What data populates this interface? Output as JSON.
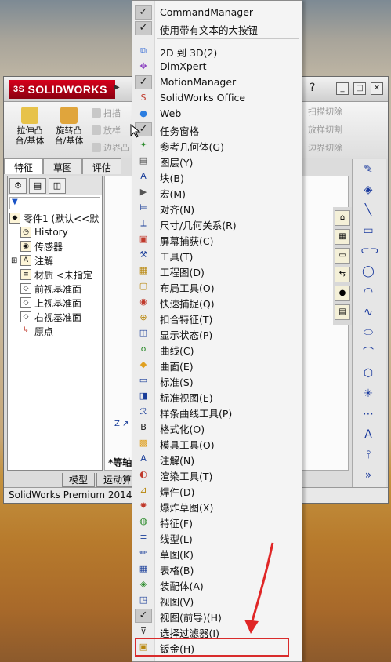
{
  "app": {
    "logo_prefix": "3S",
    "logo_text": "SOLIDWORKS",
    "help": "?",
    "window_buttons": [
      "_",
      "□",
      "✕"
    ]
  },
  "ribbon": {
    "extrude_boss": "拉伸凸台/基体",
    "revolve_boss": "旋转凸台/基体",
    "sweep": "扫描",
    "loft": "放样",
    "boundary": "边界凸",
    "sweep_cut": "扫描切除",
    "loft_cut": "放样切割",
    "boundary_cut": "边界切除"
  },
  "cm_tabs": [
    "特征",
    "草图",
    "评估"
  ],
  "feature_tree": {
    "root": "零件1 (默认<<默",
    "items": [
      "History",
      "传感器",
      "注解",
      "材质 <未指定",
      "前视基准面",
      "上视基准面",
      "右视基准面",
      "原点"
    ]
  },
  "bottom_tabs": [
    "模型",
    "运动算"
  ],
  "graphics": {
    "view_label": "*等轴",
    "axis_z": "Z"
  },
  "status_bar": "SolidWorks Premium 2014",
  "menu": {
    "items": [
      {
        "label": "CommandManager",
        "checked": true,
        "icon": "check"
      },
      {
        "label": "使用带有文本的大按钮",
        "checked": true,
        "icon": "check"
      },
      {
        "label": "2D 到 3D(2)",
        "checked": false,
        "icon": "2d3d-icon"
      },
      {
        "label": "DimXpert",
        "checked": false,
        "icon": "dimxpert-icon"
      },
      {
        "label": "MotionManager",
        "checked": true,
        "icon": "check"
      },
      {
        "label": "SolidWorks Office",
        "checked": false,
        "icon": "office-icon"
      },
      {
        "label": "Web",
        "checked": false,
        "icon": "web-icon"
      },
      {
        "label": "任务窗格",
        "checked": true,
        "icon": "check"
      },
      {
        "label": "参考几何体(G)",
        "checked": false,
        "icon": "ref-geometry-icon"
      },
      {
        "label": "图层(Y)",
        "checked": false,
        "icon": "layer-icon"
      },
      {
        "label": "块(B)",
        "checked": false,
        "icon": "block-icon"
      },
      {
        "label": "宏(M)",
        "checked": false,
        "icon": "macro-icon"
      },
      {
        "label": "对齐(N)",
        "checked": false,
        "icon": "align-icon"
      },
      {
        "label": "尺寸/几何关系(R)",
        "checked": false,
        "icon": "dimension-icon"
      },
      {
        "label": "屏幕捕获(C)",
        "checked": false,
        "icon": "screen-capture-icon"
      },
      {
        "label": "工具(T)",
        "checked": false,
        "icon": "tools-icon"
      },
      {
        "label": "工程图(D)",
        "checked": false,
        "icon": "drawing-icon"
      },
      {
        "label": "布局工具(O)",
        "checked": false,
        "icon": "layout-icon"
      },
      {
        "label": "快速捕捉(Q)",
        "checked": false,
        "icon": "quick-snap-icon"
      },
      {
        "label": "扣合特征(T)",
        "checked": false,
        "icon": "fastening-icon"
      },
      {
        "label": "显示状态(P)",
        "checked": false,
        "icon": "display-state-icon"
      },
      {
        "label": "曲线(C)",
        "checked": false,
        "icon": "curve-icon"
      },
      {
        "label": "曲面(E)",
        "checked": false,
        "icon": "surface-icon"
      },
      {
        "label": "标准(S)",
        "checked": false,
        "icon": "standard-icon"
      },
      {
        "label": "标准视图(E)",
        "checked": false,
        "icon": "standard-view-icon"
      },
      {
        "label": "样条曲线工具(P)",
        "checked": false,
        "icon": "spline-icon"
      },
      {
        "label": "格式化(O)",
        "checked": false,
        "icon": "format-icon"
      },
      {
        "label": "模具工具(O)",
        "checked": false,
        "icon": "mold-icon"
      },
      {
        "label": "注解(N)",
        "checked": false,
        "icon": "annotation-icon"
      },
      {
        "label": "渲染工具(T)",
        "checked": false,
        "icon": "render-icon"
      },
      {
        "label": "焊件(D)",
        "checked": false,
        "icon": "weldment-icon"
      },
      {
        "label": "爆炸草图(X)",
        "checked": false,
        "icon": "explode-icon"
      },
      {
        "label": "特征(F)",
        "checked": false,
        "icon": "features-icon"
      },
      {
        "label": "线型(L)",
        "checked": false,
        "icon": "line-format-icon"
      },
      {
        "label": "草图(K)",
        "checked": false,
        "icon": "sketch-icon"
      },
      {
        "label": "表格(B)",
        "checked": false,
        "icon": "table-icon"
      },
      {
        "label": "装配体(A)",
        "checked": false,
        "icon": "assembly-icon"
      },
      {
        "label": "视图(V)",
        "checked": false,
        "icon": "view-icon"
      },
      {
        "label": "视图(前导)(H)",
        "checked": true,
        "icon": "check"
      },
      {
        "label": "选择过滤器(I)",
        "checked": false,
        "icon": "filter-icon"
      },
      {
        "label": "钣金(H)",
        "checked": false,
        "icon": "sheet-metal-icon"
      }
    ]
  },
  "colors": {
    "highlight_border": "#d92b2b",
    "menu_bg": "#f4f4f4",
    "check_bg": "#c9c9c9",
    "logo_red": "#d6001c"
  }
}
